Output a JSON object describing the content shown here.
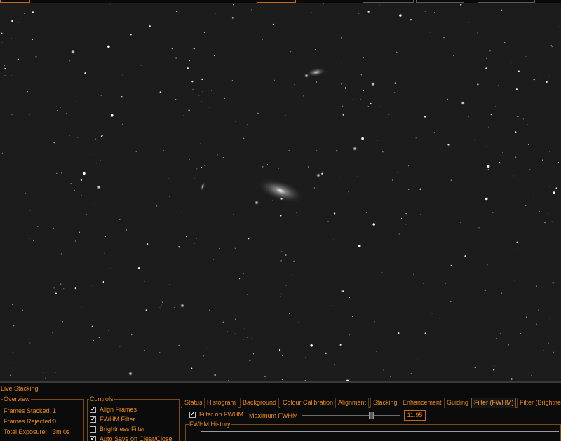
{
  "panel": {
    "title": "Live Stacking"
  },
  "overview": {
    "legend": "Overview",
    "rows": [
      {
        "label": "Frames Stacked:",
        "value": "1"
      },
      {
        "label": "Frames Rejected:",
        "value": "0"
      },
      {
        "label": "Total Exposure:",
        "value": "3m 0s"
      }
    ]
  },
  "controls": {
    "legend": "Controls",
    "items": [
      {
        "label": "Align Frames",
        "checked": true
      },
      {
        "label": "FWHM Filter",
        "checked": true
      },
      {
        "label": "Brightness Filter",
        "checked": false
      },
      {
        "label": "Auto Save on Clear/Close",
        "checked": true
      }
    ]
  },
  "tabs": [
    {
      "label": "Status"
    },
    {
      "label": "Histogram"
    },
    {
      "label": "Background"
    },
    {
      "label": "Colour Calibration"
    },
    {
      "label": "Alignment"
    },
    {
      "label": "Stacking"
    },
    {
      "label": "Enhancement"
    },
    {
      "label": "Guiding"
    },
    {
      "label": "Filter (FWHM)",
      "active": true
    },
    {
      "label": "Filter (Brightness"
    }
  ],
  "fwhm": {
    "filter_label": "Filter on FWHM",
    "filter_checked": true,
    "max_label": "Maximum FWHM",
    "max_value": "11.95",
    "slider_fraction": 0.7,
    "history_legend": "FWHM History"
  },
  "colors": {
    "accent": "#e8891a",
    "sky": "#1c1c1c",
    "panel_bg": "#0b0b0b"
  }
}
